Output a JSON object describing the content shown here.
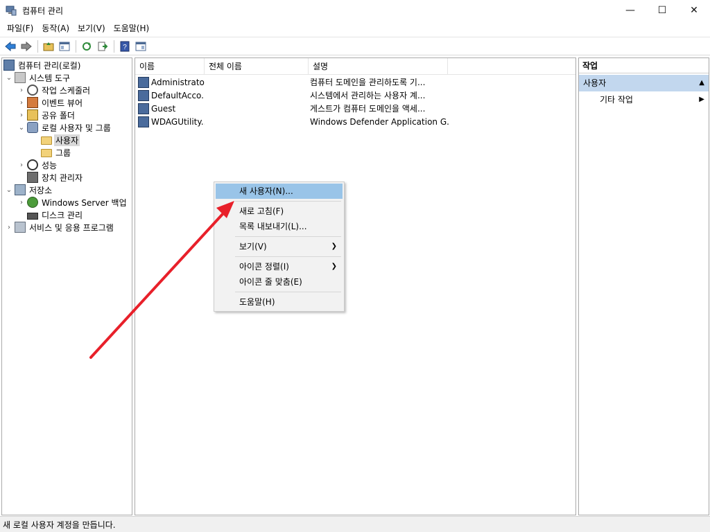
{
  "window": {
    "title": "컴퓨터 관리",
    "minimize": "—",
    "maximize": "☐",
    "close": "✕"
  },
  "menubar": [
    "파일(F)",
    "동작(A)",
    "보기(V)",
    "도움말(H)"
  ],
  "tree": {
    "root": "컴퓨터 관리(로컬)",
    "system_tools": "시스템 도구",
    "task_scheduler": "작업 스케줄러",
    "event_viewer": "이벤트 뷰어",
    "shared_folders": "공유 폴더",
    "local_users_groups": "로컬 사용자 및 그룹",
    "users": "사용자",
    "groups": "그룹",
    "performance": "성능",
    "device_manager": "장치 관리자",
    "storage": "저장소",
    "windows_server_backup": "Windows Server 백업",
    "disk_management": "디스크 관리",
    "services_apps": "서비스 및 응용 프로그램"
  },
  "list": {
    "columns": [
      "이름",
      "전체 이름",
      "설명"
    ],
    "rows": [
      {
        "name": "Administrator",
        "full_name": "",
        "description": "컴퓨터 도메인을 관리하도록 기..."
      },
      {
        "name": "DefaultAcco...",
        "full_name": "",
        "description": "시스템에서 관리하는 사용자 계..."
      },
      {
        "name": "Guest",
        "full_name": "",
        "description": "게스트가 컴퓨터 도메인을 액세..."
      },
      {
        "name": "WDAGUtility...",
        "full_name": "",
        "description": "Windows Defender Application G..."
      }
    ]
  },
  "actions": {
    "title": "작업",
    "section": "사용자",
    "more": "기타 작업"
  },
  "context_menu": {
    "new_user": "새 사용자(N)...",
    "refresh": "새로 고침(F)",
    "export_list": "목록 내보내기(L)...",
    "view": "보기(V)",
    "arrange_icons": "아이콘 정렬(I)",
    "line_up_icons": "아이콘 줄 맞춤(E)",
    "help": "도움말(H)"
  },
  "status_bar": "새 로컬 사용자 계정을 만듭니다.",
  "colors": {
    "selection": "#99c4e8",
    "actions_header": "#c2d7ee",
    "annotation_arrow": "#e8202a"
  }
}
